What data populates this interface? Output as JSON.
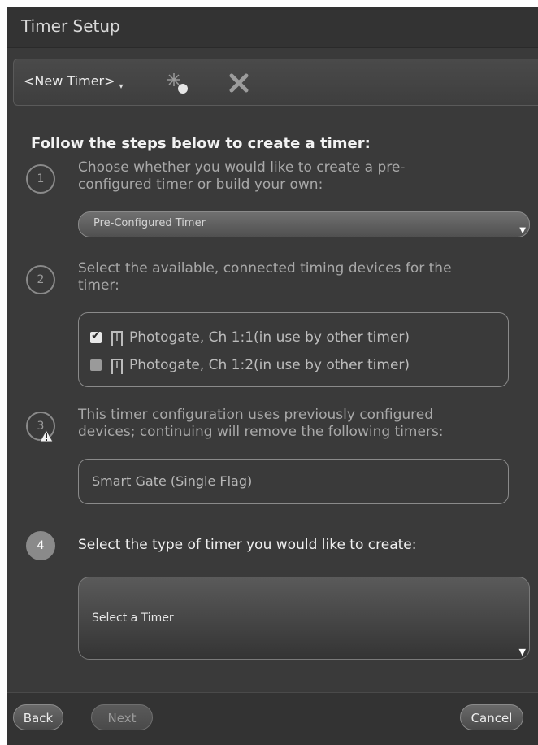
{
  "window": {
    "title": "Timer Setup"
  },
  "toolbar": {
    "timer_select_label": "<New Timer>",
    "new_timer_icon": "new-timer-icon",
    "delete_icon": "close-icon"
  },
  "heading": "Follow the steps below to create a timer:",
  "steps": [
    {
      "number": "1",
      "text_line1": "Choose whether you would like to create a pre-",
      "text_line2": "configured timer or build your own:",
      "dropdown_value": "Pre-Configured Timer"
    },
    {
      "number": "2",
      "text_line1": "Select the available, connected timing devices for the",
      "text_line2": "timer:",
      "devices": [
        {
          "label": "Photogate, Ch 1:1(in use by other timer)",
          "checked": true
        },
        {
          "label": "Photogate, Ch 1:2(in use by other timer)",
          "checked": false
        }
      ]
    },
    {
      "number": "3",
      "text_line1": "This timer configuration uses previously configured",
      "text_line2": "devices; continuing will remove the following timers:",
      "warning_icon": "warning-icon",
      "timers_to_remove": [
        "Smart Gate (Single Flag)"
      ]
    },
    {
      "number": "4",
      "text_line1": "Select the type of timer you would like to create:",
      "dropdown_value": "Select a Timer"
    }
  ],
  "footer": {
    "back_label": "Back",
    "next_label": "Next",
    "cancel_label": "Cancel"
  },
  "colors": {
    "panel_bg": "#3a3a3a",
    "title_bg": "#333333",
    "active_step": "#8a8a8a"
  }
}
